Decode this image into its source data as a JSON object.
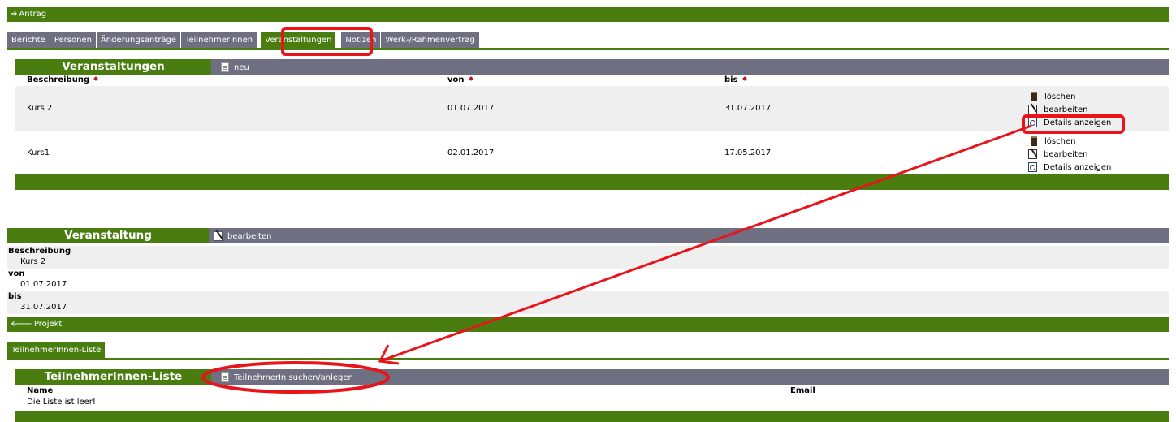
{
  "top_bar": {
    "label": "Antrag"
  },
  "tabs": [
    {
      "label": "Berichte"
    },
    {
      "label": "Personen"
    },
    {
      "label": "Änderungsanträge"
    },
    {
      "label": "TeilnehmerInnen"
    },
    {
      "label": "Veranstaltungen",
      "active": true
    },
    {
      "label": "Notizen"
    },
    {
      "label": "Werk-/Rahmenvertrag"
    }
  ],
  "events_panel": {
    "title": "Veranstaltungen",
    "new_label": "neu",
    "columns": {
      "description": "Beschreibung",
      "from": "von",
      "to": "bis"
    },
    "rows": [
      {
        "description": "Kurs 2",
        "from": "01.07.2017",
        "to": "31.07.2017"
      },
      {
        "description": "Kurs1",
        "from": "02.01.2017",
        "to": "17.05.2017"
      }
    ],
    "actions": {
      "delete": "löschen",
      "edit": "bearbeiten",
      "details": "Details anzeigen"
    }
  },
  "event_detail": {
    "title": "Veranstaltung",
    "edit_label": "bearbeiten",
    "description_label": "Beschreibung",
    "description_value": "Kurs 2",
    "from_label": "von",
    "from_value": "01.07.2017",
    "to_label": "bis",
    "to_value": "31.07.2017"
  },
  "project_bar": {
    "label": "Projekt"
  },
  "participants_tab": {
    "label": "TeilnehmerInnen-Liste"
  },
  "participants_panel": {
    "title": "TeilnehmerInnen-Liste",
    "search_label": "TeilnehmerIn suchen/anlegen",
    "name_header": "Name",
    "email_header": "Email",
    "empty_text": "Die Liste ist leer!"
  },
  "colors": {
    "green": "#4a7d10",
    "slate": "#6e7082",
    "annotation_red": "#e8141a",
    "sort_marker": "#c0171b",
    "row_alt": "#efefef"
  }
}
